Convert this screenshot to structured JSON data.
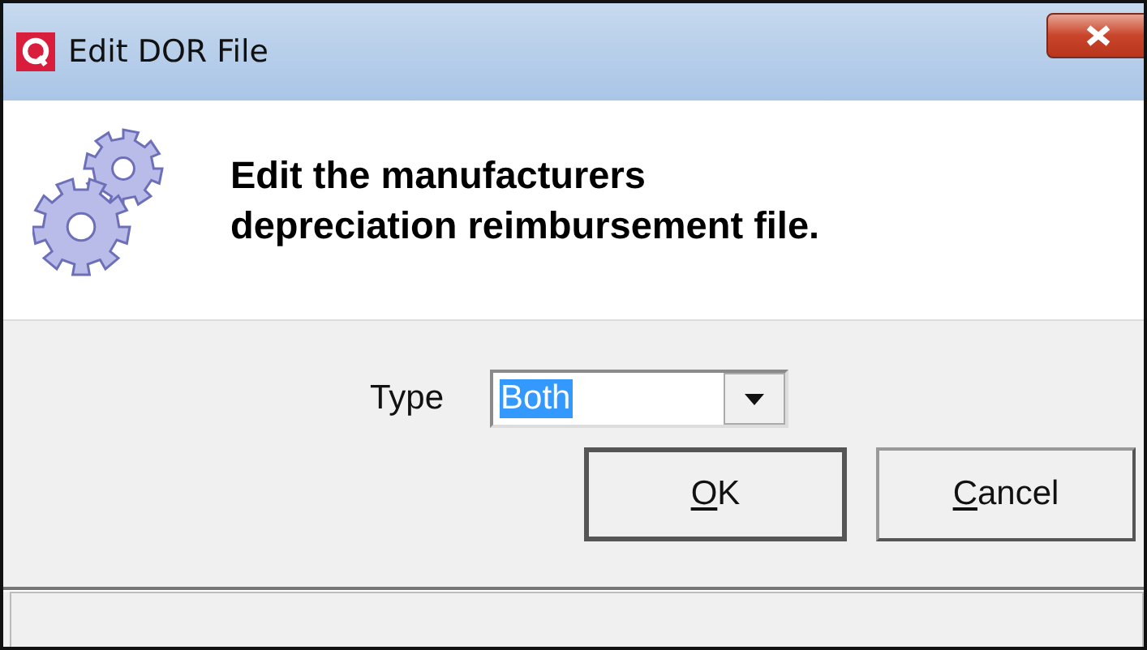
{
  "window": {
    "title": "Edit DOR File"
  },
  "header": {
    "text": "Edit the manufacturers\ndepreciation reimbursement file."
  },
  "type_field": {
    "label": "Type",
    "value": "Both",
    "text_selected": true
  },
  "buttons": [
    {
      "label": "OK",
      "default": true
    },
    {
      "label": "Cancel",
      "default": false
    }
  ]
}
